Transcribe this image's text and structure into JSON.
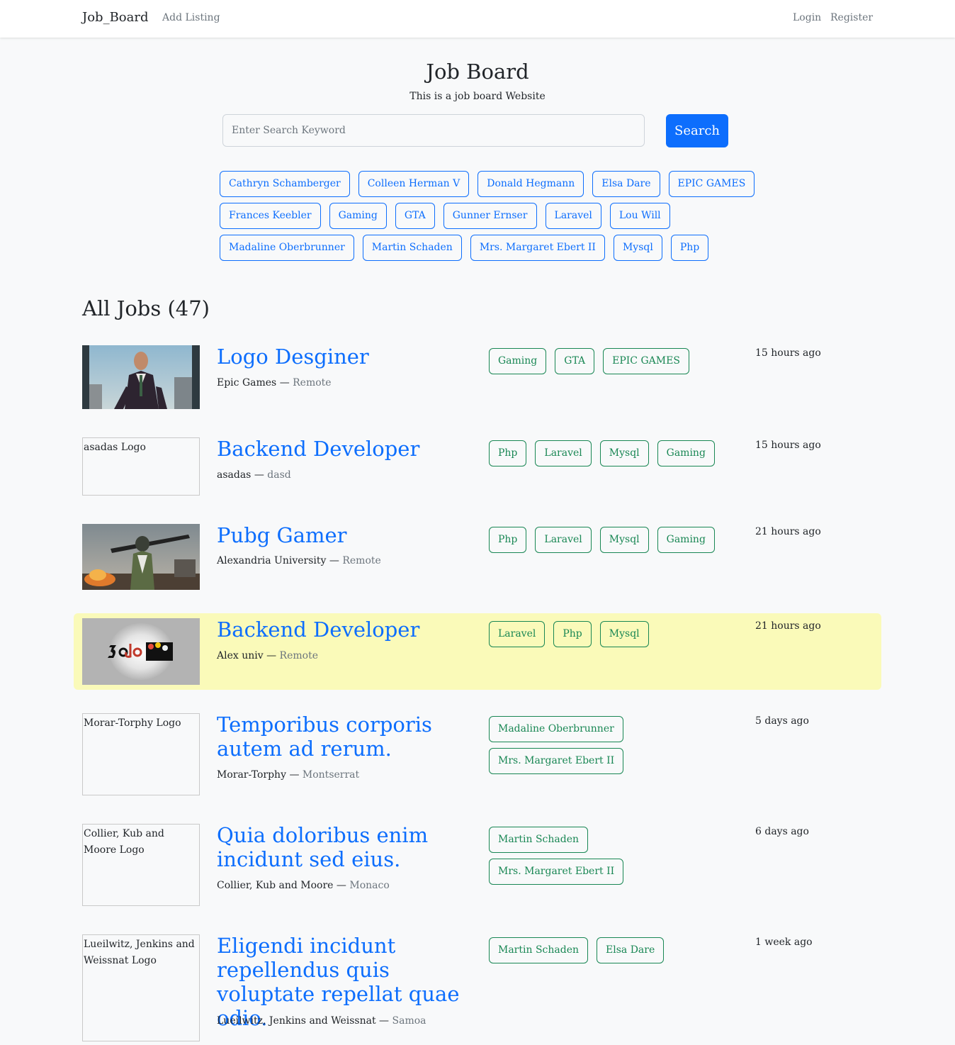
{
  "nav": {
    "brand": "Job_Board",
    "add_listing": "Add Listing",
    "login": "Login",
    "register": "Register"
  },
  "hero": {
    "title": "Job Board",
    "subtitle": "This is a job board Website",
    "search_placeholder": "Enter Search Keyword",
    "search_button": "Search"
  },
  "tags": [
    "Cathryn Schamberger",
    "Colleen Herman V",
    "Donald Hegmann",
    "Elsa Dare",
    "EPIC GAMES",
    "Frances Keebler",
    "Gaming",
    "GTA",
    "Gunner Ernser",
    "Laravel",
    "Lou Will",
    "Madaline Oberbrunner",
    "Martin Schaden",
    "Mrs. Margaret Ebert II",
    "Mysql",
    "Php"
  ],
  "all_jobs": {
    "label": "All Jobs",
    "count": "(47)"
  },
  "colors": {
    "primary": "#0d6efd",
    "success": "#198754",
    "featured_bg": "#fafab9",
    "muted": "#6c757d"
  },
  "jobs": [
    {
      "title": "Logo Desginer",
      "company": "Epic Games",
      "separator": "—",
      "location": "Remote",
      "tags": [
        "Gaming",
        "GTA",
        "EPIC GAMES"
      ],
      "posted": "15 hours ago",
      "logo_alt": "",
      "logo_image": "gta-character"
    },
    {
      "title": "Backend Developer",
      "company": "asadas",
      "separator": "—",
      "location": "dasd",
      "tags": [
        "Php",
        "Laravel",
        "Mysql",
        "Gaming"
      ],
      "posted": "15 hours ago",
      "logo_alt": "asadas Logo",
      "logo_image": ""
    },
    {
      "title": "Pubg Gamer",
      "company": "Alexandria University",
      "separator": "—",
      "location": "Remote",
      "tags": [
        "Php",
        "Laravel",
        "Mysql",
        "Gaming"
      ],
      "posted": "21 hours ago",
      "logo_alt": "",
      "logo_image": "pubg-character"
    },
    {
      "title": "Backend Developer",
      "company": "Alex univ",
      "separator": "—",
      "location": "Remote",
      "tags": [
        "Laravel",
        "Php",
        "Mysql"
      ],
      "posted": "21 hours ago",
      "logo_alt": "",
      "logo_image": "3edo-logo",
      "featured": true
    },
    {
      "title": "Temporibus corporis autem ad rerum.",
      "company": "Morar-Torphy",
      "separator": "—",
      "location": "Montserrat",
      "tags": [
        "Madaline Oberbrunner",
        "Mrs. Margaret Ebert II"
      ],
      "posted": "5 days ago",
      "logo_alt": "Morar-Torphy Logo",
      "logo_image": ""
    },
    {
      "title": "Quia doloribus enim incidunt sed eius.",
      "company": "Collier, Kub and Moore",
      "separator": "—",
      "location": "Monaco",
      "tags": [
        "Martin Schaden",
        "Mrs. Margaret Ebert II"
      ],
      "posted": "6 days ago",
      "logo_alt": "Collier, Kub and Moore Logo",
      "logo_image": ""
    },
    {
      "title": "Eligendi incidunt repellendus quis voluptate repellat quae odio.",
      "company": "Lueilwitz, Jenkins and Weissnat",
      "separator": "—",
      "location": "Samoa",
      "tags": [
        "Martin Schaden",
        "Elsa Dare"
      ],
      "posted": "1 week ago",
      "logo_alt": "Lueilwitz, Jenkins and Weissnat Logo",
      "logo_image": ""
    }
  ]
}
